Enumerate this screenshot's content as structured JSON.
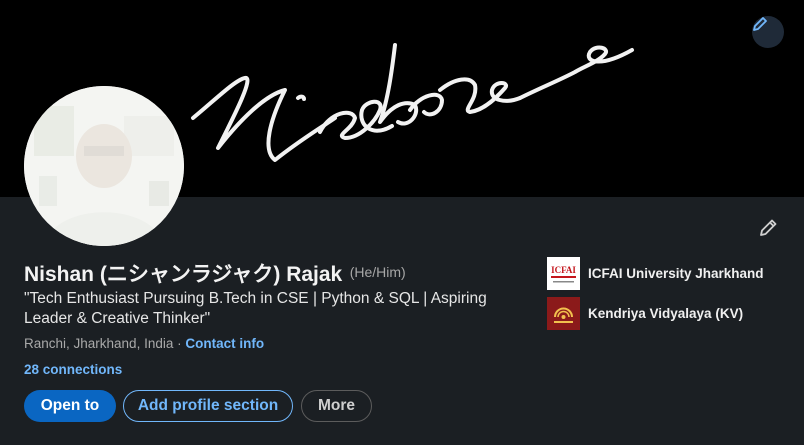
{
  "profile": {
    "name": "Nishan (ニシャンラジャク) Rajak",
    "pronouns": "(He/Him)",
    "headline": "\"Tech Enthusiast Pursuing B.Tech in CSE | Python & SQL | Aspiring Leader & Creative Thinker\"",
    "location": "Ranchi, Jharkhand, India",
    "separator": "·",
    "contact_info": "Contact info",
    "connections": "28 connections"
  },
  "actions": {
    "open_to": "Open to",
    "add_section": "Add profile section",
    "more": "More"
  },
  "education": [
    {
      "name": "ICFAI University Jharkhand",
      "logo_text": "ICFAI"
    },
    {
      "name": "Kendriya Vidyalaya (KV)"
    }
  ],
  "icons": {
    "banner_edit": "pencil-icon",
    "profile_edit": "pencil-icon"
  },
  "colors": {
    "background": "#1b1f23",
    "banner": "#000000",
    "accent_link": "#71b7fb",
    "primary_button": "#0a66c2",
    "icfai_red": "#c4161c",
    "kv_maroon": "#8b1a1a"
  }
}
